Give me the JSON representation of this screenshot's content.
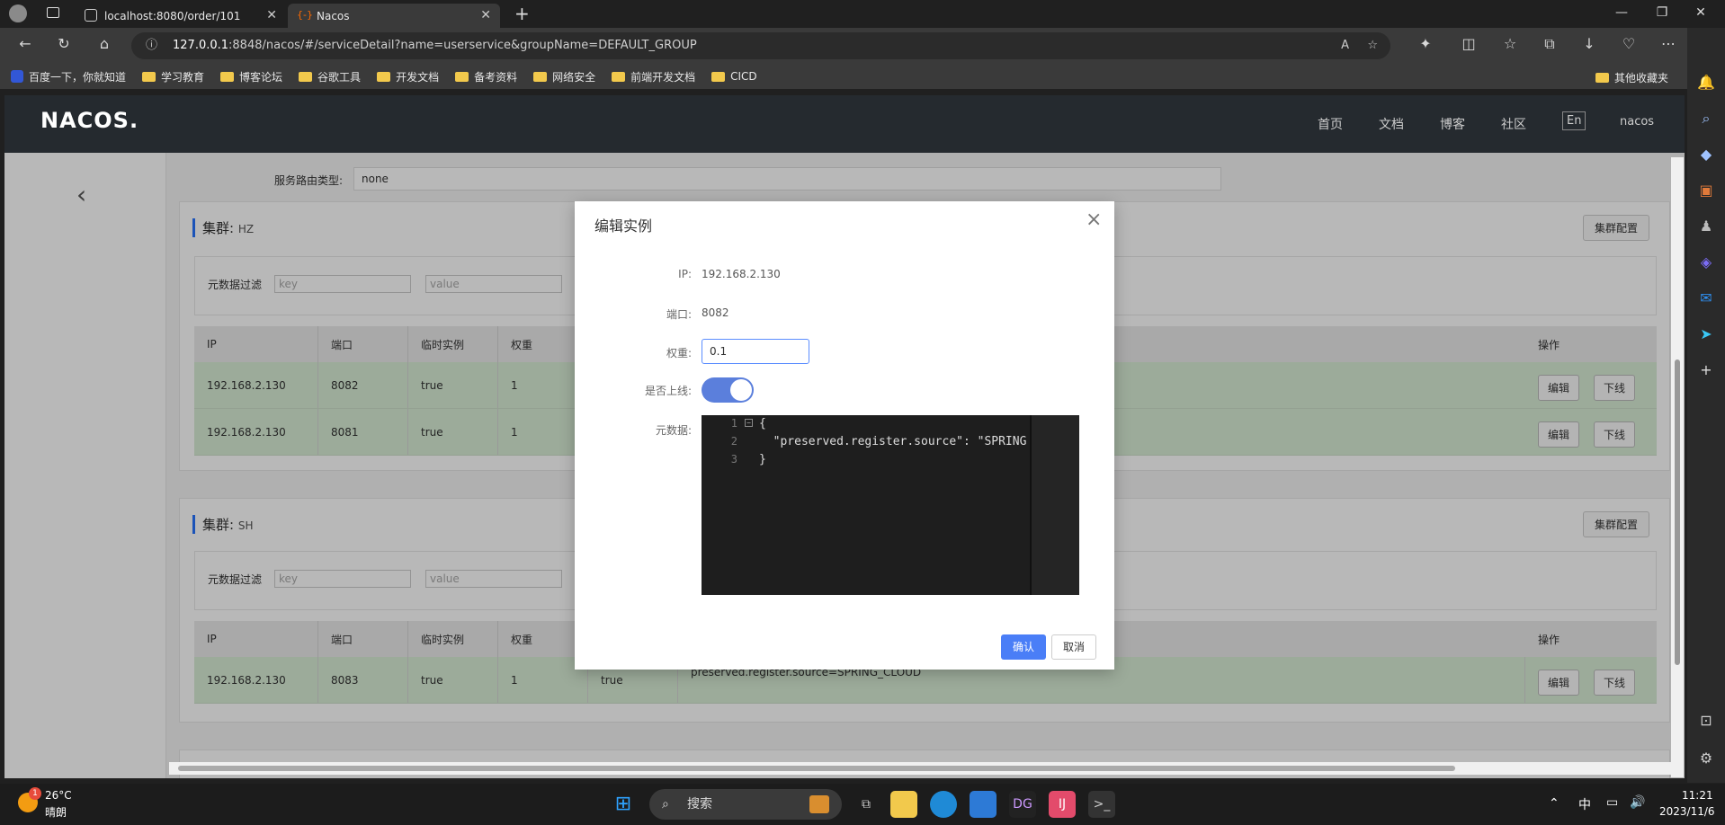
{
  "browser": {
    "tabs": [
      {
        "title": "localhost:8080/order/101"
      },
      {
        "title": "Nacos"
      }
    ],
    "address": {
      "host": "127.0.0.1",
      "rest": ":8848/nacos/#/serviceDetail?name=userservice&groupName=DEFAULT_GROUP"
    },
    "bookmarks": [
      "百度一下，你就知道",
      "学习教育",
      "博客论坛",
      "谷歌工具",
      "开发文档",
      "备考资料",
      "网络安全",
      "前端开发文档",
      "CICD"
    ],
    "other_bookmarks": "其他收藏夹"
  },
  "nacos": {
    "logo": "NACOS.",
    "nav": [
      "首页",
      "文档",
      "博客",
      "社区"
    ],
    "lang_button": "En",
    "user": "nacos",
    "route_type_label": "服务路由类型:",
    "route_type_value": "none",
    "clusters": [
      {
        "title": "集群:",
        "name": "HZ",
        "config_button": "集群配置",
        "filter_label": "元数据过滤",
        "key_placeholder": "key",
        "value_placeholder": "value",
        "columns": [
          "IP",
          "端口",
          "临时实例",
          "权重",
          "操作"
        ],
        "rows": [
          {
            "ip": "192.168.2.130",
            "port": "8082",
            "ephemeral": "true",
            "weight": "1",
            "edit": "编辑",
            "offline": "下线"
          },
          {
            "ip": "192.168.2.130",
            "port": "8081",
            "ephemeral": "true",
            "weight": "1",
            "edit": "编辑",
            "offline": "下线"
          }
        ]
      },
      {
        "title": "集群:",
        "name": "SH",
        "config_button": "集群配置",
        "filter_label": "元数据过滤",
        "key_placeholder": "key",
        "value_placeholder": "value",
        "columns": [
          "IP",
          "端口",
          "临时实例",
          "权重",
          "操作"
        ],
        "rows": [
          {
            "ip": "192.168.2.130",
            "port": "8083",
            "ephemeral": "true",
            "weight": "1",
            "healthy": "true",
            "metadata": "preserved.register.source=SPRING_CLOUD",
            "edit": "编辑",
            "offline": "下线"
          }
        ]
      }
    ]
  },
  "dialog": {
    "title": "编辑实例",
    "ip_label": "IP:",
    "ip_value": "192.168.2.130",
    "port_label": "端口:",
    "port_value": "8082",
    "weight_label": "权重:",
    "weight_value": "0.1",
    "online_label": "是否上线:",
    "online": true,
    "metadata_label": "元数据:",
    "code_lines": [
      "{",
      "  \"preserved.register.source\": \"SPRING",
      "}"
    ],
    "line_numbers": [
      "1",
      "2",
      "3"
    ],
    "ok": "确认",
    "cancel": "取消"
  },
  "taskbar": {
    "weather_temp": "26°C",
    "weather_desc": "晴朗",
    "weather_badge": "1",
    "search": "搜索",
    "ime": "中",
    "time": "11:21",
    "date": "2023/11/6"
  }
}
